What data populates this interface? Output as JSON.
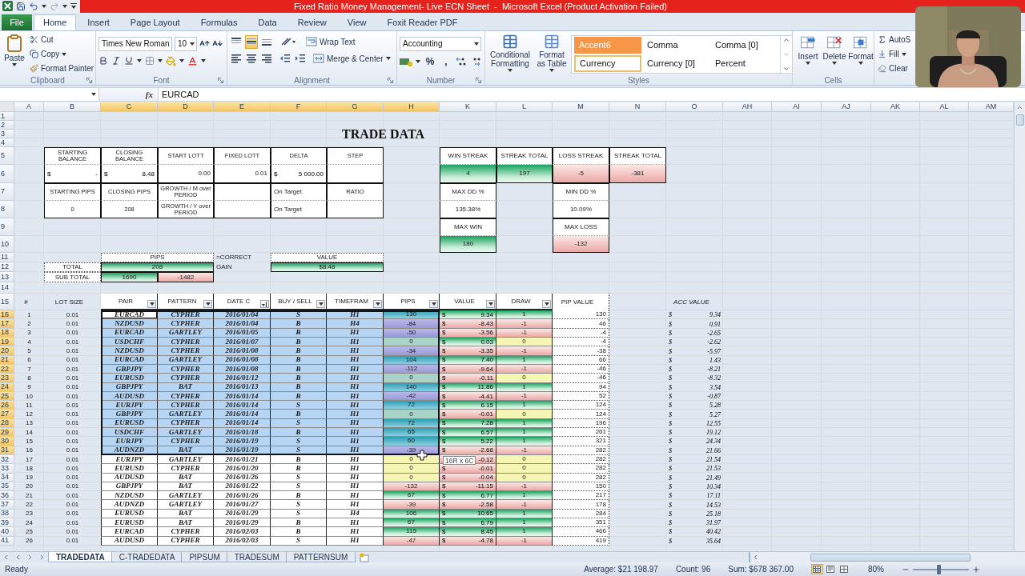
{
  "title_bar": {
    "title": "Fixed Ratio Money Management- Live ECN Sheet  -  Microsoft Excel (Product Activation Failed)"
  },
  "ribbon_tabs": [
    {
      "label": "File",
      "kind": "file",
      "selected": false
    },
    {
      "label": "Home",
      "kind": "tab",
      "selected": true
    },
    {
      "label": "Insert",
      "kind": "tab",
      "selected": false
    },
    {
      "label": "Page Layout",
      "kind": "tab",
      "selected": false
    },
    {
      "label": "Formulas",
      "kind": "tab",
      "selected": false
    },
    {
      "label": "Data",
      "kind": "tab",
      "selected": false
    },
    {
      "label": "Review",
      "kind": "tab",
      "selected": false
    },
    {
      "label": "View",
      "kind": "tab",
      "selected": false
    },
    {
      "label": "Foxit Reader PDF",
      "kind": "tab",
      "selected": false
    }
  ],
  "clipboard": {
    "paste": "Paste",
    "cut": "Cut",
    "copy": "Copy",
    "format_painter": "Format Painter",
    "label": "Clipboard"
  },
  "font": {
    "name": "Times New Roman",
    "size": "10",
    "label": "Font"
  },
  "alignment": {
    "vertical": [
      {
        "selected": false
      },
      {
        "selected": true
      },
      {
        "selected": false
      }
    ],
    "wrap_text": "Wrap Text",
    "merge": "Merge & Center",
    "label": "Alignment"
  },
  "number": {
    "format": "Accounting",
    "percent": "%",
    "comma": ",",
    "label": "Number"
  },
  "styles": {
    "conditional": "Conditional Formatting",
    "format_table": "Format as Table",
    "label": "Styles",
    "gallery": [
      {
        "label": "Accent6",
        "kind": "accent",
        "selected": false
      },
      {
        "label": "Comma",
        "kind": "plain",
        "selected": false
      },
      {
        "label": "Comma [0]",
        "kind": "plain",
        "selected": false
      },
      {
        "label": "Currency",
        "kind": "plain",
        "selected": true
      },
      {
        "label": "Currency [0]",
        "kind": "plain",
        "selected": false
      },
      {
        "label": "Percent",
        "kind": "plain",
        "selected": false
      }
    ]
  },
  "cells": {
    "buttons": [
      "Insert",
      "Delete",
      "Format"
    ],
    "label": "Cells"
  },
  "editing": {
    "autosum": "AutoS",
    "fill": "Fill",
    "clear": "Clear"
  },
  "formula_bar": {
    "fx": "fx",
    "value": "EURCAD"
  },
  "column_headers": [
    {
      "label": "A",
      "selected": false
    },
    {
      "label": "B",
      "selected": false
    },
    {
      "label": "C",
      "selected": true
    },
    {
      "label": "D",
      "selected": true
    },
    {
      "label": "E",
      "selected": true
    },
    {
      "label": "F",
      "selected": true
    },
    {
      "label": "G",
      "selected": true
    },
    {
      "label": "H",
      "selected": true
    },
    {
      "label": "K",
      "selected": false
    },
    {
      "label": "L",
      "selected": false
    },
    {
      "label": "M",
      "selected": false
    },
    {
      "label": "N",
      "selected": false
    },
    {
      "label": "O",
      "selected": false
    },
    {
      "label": "AH",
      "selected": false
    },
    {
      "label": "AI",
      "selected": false
    },
    {
      "label": "AJ",
      "selected": false
    },
    {
      "label": "AK",
      "selected": false
    },
    {
      "label": "AL",
      "selected": false
    },
    {
      "label": "AM",
      "selected": false
    }
  ],
  "row_headers": [
    {
      "label": "1",
      "selected": false
    },
    {
      "label": "2",
      "selected": false
    },
    {
      "label": "3",
      "selected": false
    },
    {
      "label": "4",
      "selected": false
    },
    {
      "label": "5",
      "selected": false
    },
    {
      "label": "6",
      "selected": false
    },
    {
      "label": "7",
      "selected": false
    },
    {
      "label": "8",
      "selected": false
    },
    {
      "label": "9",
      "selected": false
    },
    {
      "label": "10",
      "selected": false
    },
    {
      "label": "11",
      "selected": false
    },
    {
      "label": "12",
      "selected": false
    },
    {
      "label": "13",
      "selected": false
    },
    {
      "label": "14",
      "selected": false
    },
    {
      "label": "15",
      "selected": false
    },
    {
      "label": "16",
      "selected": true
    },
    {
      "label": "17",
      "selected": true
    },
    {
      "label": "18",
      "selected": true
    },
    {
      "label": "19",
      "selected": true
    },
    {
      "label": "20",
      "selected": true
    },
    {
      "label": "21",
      "selected": true
    },
    {
      "label": "22",
      "selected": true
    },
    {
      "label": "23",
      "selected": true
    },
    {
      "label": "24",
      "selected": true
    },
    {
      "label": "25",
      "selected": true
    },
    {
      "label": "26",
      "selected": true
    },
    {
      "label": "27",
      "selected": true
    },
    {
      "label": "28",
      "selected": true
    },
    {
      "label": "29",
      "selected": true
    },
    {
      "label": "30",
      "selected": true
    },
    {
      "label": "31",
      "selected": true
    },
    {
      "label": "32",
      "selected": false
    },
    {
      "label": "33",
      "selected": false
    },
    {
      "label": "34",
      "selected": false
    },
    {
      "label": "35",
      "selected": false
    },
    {
      "label": "36",
      "selected": false
    },
    {
      "label": "37",
      "selected": false
    },
    {
      "label": "38",
      "selected": false
    },
    {
      "label": "39",
      "selected": false
    },
    {
      "label": "40",
      "selected": false
    },
    {
      "label": "41",
      "selected": false
    }
  ],
  "sheet_title": "TRADE DATA",
  "summary": [
    [
      {
        "kind": "label",
        "text": "STARTING BALANCE"
      },
      {
        "kind": "label",
        "text": "CLOSING BALANCE"
      },
      {
        "kind": "label",
        "text": "START LOTT"
      },
      {
        "kind": "label",
        "text": "FIXED LOTT"
      },
      {
        "kind": "label",
        "text": "DELTA"
      },
      {
        "kind": "label",
        "text": "STEP"
      }
    ],
    [
      {
        "kind": "money",
        "symbol": "$",
        "text": "-"
      },
      {
        "kind": "money",
        "symbol": "$",
        "text": "8.48"
      },
      {
        "kind": "number",
        "text": "0.00"
      },
      {
        "kind": "number",
        "text": "0.01"
      },
      {
        "kind": "money",
        "symbol": "$",
        "text": "5 000.00"
      },
      {
        "kind": "empty"
      }
    ],
    [
      {
        "kind": "label",
        "text": "STARTING PIPS"
      },
      {
        "kind": "label",
        "text": "CLOSING PIPS"
      },
      {
        "kind": "label",
        "text": "GROWTH / M over PERIOD"
      },
      {
        "kind": "empty"
      },
      {
        "kind": "note",
        "text": "On Target"
      },
      {
        "kind": "label",
        "text": "RATIO"
      }
    ],
    [
      {
        "kind": "label",
        "text": "0"
      },
      {
        "kind": "label",
        "text": "208"
      },
      {
        "kind": "label",
        "text": "GROWTH / Y over PERIOD"
      },
      {
        "kind": "empty"
      },
      {
        "kind": "note",
        "text": "On Target"
      },
      {
        "kind": "empty"
      }
    ]
  ],
  "streaks": [
    {
      "label": "WIN STREAK",
      "value": "4",
      "kind": "win"
    },
    {
      "label": "STREAK TOTAL",
      "value": "197",
      "kind": "win"
    },
    {
      "label": "LOSS STREAK",
      "value": "-5",
      "kind": "loss"
    },
    {
      "label": "STREAK TOTAL",
      "value": "-381",
      "kind": "loss"
    }
  ],
  "stats": [
    [
      {
        "label": "MAX DD %",
        "value": "135.38%",
        "kind": "plain"
      },
      {
        "label": "MAX WIN",
        "value": "180",
        "kind": "win"
      }
    ],
    [
      {
        "label": "MIN DD %",
        "value": "10.09%",
        "kind": "plain"
      },
      {
        "label": "MAX LOSS",
        "value": "-132",
        "kind": "loss"
      }
    ]
  ],
  "totals": {
    "pips_label": "PIPS",
    "marker": "=CORRECT",
    "value_label": "VALUE",
    "total_label": "TOTAL",
    "total_pips": "208",
    "status": "GAIN",
    "total_value": "$8.48",
    "subtotal_label": "SUB TOTAL",
    "gains": "1690",
    "losses": "-1482"
  },
  "trade_columns": [
    {
      "label": "#",
      "kind": "none"
    },
    {
      "label": "LOT SIZE",
      "kind": "none"
    },
    {
      "label": "PAIR",
      "kind": "dropdown"
    },
    {
      "label": "PATTERN",
      "kind": "dropdown"
    },
    {
      "label": "DATE C",
      "kind": "sorted"
    },
    {
      "label": "BUY / SELL",
      "kind": "dropdown"
    },
    {
      "label": "TIMEFRAM",
      "kind": "dropdown"
    },
    {
      "label": "PIPS",
      "kind": "dropdown"
    },
    {
      "label": "VALUE",
      "kind": "dropdown"
    },
    {
      "label": "DRAW",
      "kind": "dropdown"
    },
    {
      "label": "PIP VALUE",
      "kind": "none"
    },
    {
      "label": "ACC VALUE",
      "kind": "none"
    }
  ],
  "trades": [
    {
      "num": "1",
      "lot": "0.01",
      "pair": "EURCAD",
      "pattern": "CYPHER",
      "date": "2016/01/04",
      "side": "S",
      "timeframe": "H1",
      "pips": "130",
      "value": {
        "symbol": "$",
        "amount": "9.34"
      },
      "draw": "1",
      "pip_value": "130",
      "acc_value": {
        "symbol": "$",
        "amount": "9.34"
      },
      "kind": "win",
      "gain": true,
      "selected": true,
      "active": true
    },
    {
      "num": "2",
      "lot": "0.01",
      "pair": "NZDUSD",
      "pattern": "CYPHER",
      "date": "2016/01/04",
      "side": "B",
      "timeframe": "H4",
      "pips": "-84",
      "value": {
        "symbol": "$",
        "amount": "-8.43"
      },
      "draw": "-1",
      "pip_value": "46",
      "acc_value": {
        "symbol": "$",
        "amount": "0.91"
      },
      "kind": "loss",
      "gain": false,
      "selected": true,
      "active": false
    },
    {
      "num": "3",
      "lot": "0.01",
      "pair": "EURCAD",
      "pattern": "GARTLEY",
      "date": "2016/01/05",
      "side": "B",
      "timeframe": "H1",
      "pips": "-50",
      "value": {
        "symbol": "$",
        "amount": "-3.56"
      },
      "draw": "-1",
      "pip_value": "-4",
      "acc_value": {
        "symbol": "$",
        "amount": "-2.65"
      },
      "kind": "loss",
      "gain": false,
      "selected": true,
      "active": false
    },
    {
      "num": "4",
      "lot": "0.01",
      "pair": "USDCHF",
      "pattern": "CYPHER",
      "date": "2016/01/07",
      "side": "B",
      "timeframe": "H1",
      "pips": "0",
      "value": {
        "symbol": "$",
        "amount": "0.03"
      },
      "draw": "0",
      "pip_value": "-4",
      "acc_value": {
        "symbol": "$",
        "amount": "-2.62"
      },
      "kind": "even",
      "gain": true,
      "selected": true,
      "active": false
    },
    {
      "num": "5",
      "lot": "0.01",
      "pair": "NZDUSD",
      "pattern": "CYPHER",
      "date": "2016/01/08",
      "side": "B",
      "timeframe": "H1",
      "pips": "-34",
      "value": {
        "symbol": "$",
        "amount": "-3.35"
      },
      "draw": "-1",
      "pip_value": "-38",
      "acc_value": {
        "symbol": "$",
        "amount": "-5.97"
      },
      "kind": "loss",
      "gain": false,
      "selected": true,
      "active": false
    },
    {
      "num": "6",
      "lot": "0.01",
      "pair": "EURCAD",
      "pattern": "GARTLEY",
      "date": "2016/01/08",
      "side": "B",
      "timeframe": "H1",
      "pips": "104",
      "value": {
        "symbol": "$",
        "amount": "7.40"
      },
      "draw": "1",
      "pip_value": "66",
      "acc_value": {
        "symbol": "$",
        "amount": "1.43"
      },
      "kind": "win",
      "gain": true,
      "selected": true,
      "active": false
    },
    {
      "num": "7",
      "lot": "0.01",
      "pair": "GBPJPY",
      "pattern": "CYPHER",
      "date": "2016/01/08",
      "side": "B",
      "timeframe": "H1",
      "pips": "-112",
      "value": {
        "symbol": "$",
        "amount": "-9.64"
      },
      "draw": "-1",
      "pip_value": "-46",
      "acc_value": {
        "symbol": "$",
        "amount": "-8.21"
      },
      "kind": "loss",
      "gain": false,
      "selected": true,
      "active": false
    },
    {
      "num": "8",
      "lot": "0.01",
      "pair": "EURUSD",
      "pattern": "CYPHER",
      "date": "2016/01/12",
      "side": "B",
      "timeframe": "H1",
      "pips": "0",
      "value": {
        "symbol": "$",
        "amount": "-0.11"
      },
      "draw": "0",
      "pip_value": "-46",
      "acc_value": {
        "symbol": "$",
        "amount": "-8.32"
      },
      "kind": "even",
      "gain": false,
      "selected": true,
      "active": false
    },
    {
      "num": "9",
      "lot": "0.01",
      "pair": "GBPJPY",
      "pattern": "BAT",
      "date": "2016/01/13",
      "side": "B",
      "timeframe": "H1",
      "pips": "140",
      "value": {
        "symbol": "$",
        "amount": "11.86"
      },
      "draw": "1",
      "pip_value": "94",
      "acc_value": {
        "symbol": "$",
        "amount": "3.54"
      },
      "kind": "win",
      "gain": true,
      "selected": true,
      "active": false
    },
    {
      "num": "10",
      "lot": "0.01",
      "pair": "AUDUSD",
      "pattern": "CYPHER",
      "date": "2016/01/14",
      "side": "B",
      "timeframe": "H1",
      "pips": "-42",
      "value": {
        "symbol": "$",
        "amount": "-4.41"
      },
      "draw": "-1",
      "pip_value": "52",
      "acc_value": {
        "symbol": "$",
        "amount": "-0.87"
      },
      "kind": "loss",
      "gain": false,
      "selected": true,
      "active": false
    },
    {
      "num": "11",
      "lot": "0.01",
      "pair": "EURJPY",
      "pattern": "CYPHER",
      "date": "2016/01/14",
      "side": "S",
      "timeframe": "H1",
      "pips": "72",
      "value": {
        "symbol": "$",
        "amount": "6.15"
      },
      "draw": "1",
      "pip_value": "124",
      "acc_value": {
        "symbol": "$",
        "amount": "5.28"
      },
      "kind": "win",
      "gain": true,
      "selected": true,
      "active": false
    },
    {
      "num": "12",
      "lot": "0.01",
      "pair": "GBPJPY",
      "pattern": "GARTLEY",
      "date": "2016/01/14",
      "side": "B",
      "timeframe": "H1",
      "pips": "0",
      "value": {
        "symbol": "$",
        "amount": "-0.01"
      },
      "draw": "0",
      "pip_value": "124",
      "acc_value": {
        "symbol": "$",
        "amount": "5.27"
      },
      "kind": "even",
      "gain": false,
      "selected": true,
      "active": false
    },
    {
      "num": "13",
      "lot": "0.01",
      "pair": "EURUSD",
      "pattern": "CYPHER",
      "date": "2016/01/14",
      "side": "S",
      "timeframe": "H1",
      "pips": "72",
      "value": {
        "symbol": "$",
        "amount": "7.28"
      },
      "draw": "1",
      "pip_value": "196",
      "acc_value": {
        "symbol": "$",
        "amount": "12.55"
      },
      "kind": "win",
      "gain": true,
      "selected": true,
      "active": false
    },
    {
      "num": "14",
      "lot": "0.01",
      "pair": "USDCHF",
      "pattern": "GARTLEY",
      "date": "2016/01/18",
      "side": "B",
      "timeframe": "H1",
      "pips": "65",
      "value": {
        "symbol": "$",
        "amount": "6.57"
      },
      "draw": "1",
      "pip_value": "261",
      "acc_value": {
        "symbol": "$",
        "amount": "19.12"
      },
      "kind": "win",
      "gain": true,
      "selected": true,
      "active": false
    },
    {
      "num": "15",
      "lot": "0.01",
      "pair": "EURJPY",
      "pattern": "CYPHER",
      "date": "2016/01/19",
      "side": "S",
      "timeframe": "H1",
      "pips": "60",
      "value": {
        "symbol": "$",
        "amount": "5.22"
      },
      "draw": "1",
      "pip_value": "321",
      "acc_value": {
        "symbol": "$",
        "amount": "24.34"
      },
      "kind": "win",
      "gain": true,
      "selected": true,
      "active": false
    },
    {
      "num": "16",
      "lot": "0.01",
      "pair": "AUDNZD",
      "pattern": "BAT",
      "date": "2016/01/19",
      "side": "S",
      "timeframe": "H1",
      "pips": "-39",
      "value": {
        "symbol": "$",
        "amount": "-2.68"
      },
      "draw": "-1",
      "pip_value": "282",
      "acc_value": {
        "symbol": "$",
        "amount": "21.66"
      },
      "kind": "loss",
      "gain": false,
      "selected": true,
      "active": false
    },
    {
      "num": "17",
      "lot": "0.01",
      "pair": "EURJPY",
      "pattern": "GARTLEY",
      "date": "2016/01/21",
      "side": "B",
      "timeframe": "H1",
      "pips": "0",
      "value": {
        "amount": "-0.12"
      },
      "draw": "0",
      "pip_value": "282",
      "acc_value": {
        "symbol": "$",
        "amount": "21.54"
      },
      "kind": "even",
      "gain": false,
      "selected": false,
      "active": false
    },
    {
      "num": "18",
      "lot": "0.01",
      "pair": "EURUSD",
      "pattern": "CYPHER",
      "date": "2016/01/20",
      "side": "B",
      "timeframe": "H1",
      "pips": "0",
      "value": {
        "symbol": "$",
        "amount": "-0.01"
      },
      "draw": "0",
      "pip_value": "282",
      "acc_value": {
        "symbol": "$",
        "amount": "21.53"
      },
      "kind": "even",
      "gain": false,
      "selected": false,
      "active": false
    },
    {
      "num": "19",
      "lot": "0.01",
      "pair": "AUDUSD",
      "pattern": "BAT",
      "date": "2016/01/26",
      "side": "S",
      "timeframe": "H1",
      "pips": "0",
      "value": {
        "symbol": "$",
        "amount": "-0.04"
      },
      "draw": "0",
      "pip_value": "282",
      "acc_value": {
        "symbol": "$",
        "amount": "21.49"
      },
      "kind": "even",
      "gain": false,
      "selected": false,
      "active": false
    },
    {
      "num": "20",
      "lot": "0.01",
      "pair": "GBPJPY",
      "pattern": "BAT",
      "date": "2016/01/22",
      "side": "S",
      "timeframe": "H1",
      "pips": "-132",
      "value": {
        "symbol": "$",
        "amount": "-11.15"
      },
      "draw": "-1",
      "pip_value": "150",
      "acc_value": {
        "symbol": "$",
        "amount": "10.34"
      },
      "kind": "loss",
      "gain": false,
      "selected": false,
      "active": false
    },
    {
      "num": "21",
      "lot": "0.01",
      "pair": "NZDUSD",
      "pattern": "GARTLEY",
      "date": "2016/01/26",
      "side": "B",
      "timeframe": "H1",
      "pips": "67",
      "value": {
        "symbol": "$",
        "amount": "6.77"
      },
      "draw": "1",
      "pip_value": "217",
      "acc_value": {
        "symbol": "$",
        "amount": "17.11"
      },
      "kind": "win",
      "gain": true,
      "selected": false,
      "active": false
    },
    {
      "num": "22",
      "lot": "0.01",
      "pair": "AUDNZD",
      "pattern": "GARTLEY",
      "date": "2016/01/27",
      "side": "S",
      "timeframe": "H1",
      "pips": "-39",
      "value": {
        "symbol": "$",
        "amount": "-2.58"
      },
      "draw": "-1",
      "pip_value": "178",
      "acc_value": {
        "symbol": "$",
        "amount": "14.53"
      },
      "kind": "loss",
      "gain": false,
      "selected": false,
      "active": false
    },
    {
      "num": "23",
      "lot": "0.01",
      "pair": "EURUSD",
      "pattern": "BAT",
      "date": "2016/01/29",
      "side": "S",
      "timeframe": "H4",
      "pips": "106",
      "value": {
        "symbol": "$",
        "amount": "10.65"
      },
      "draw": "1",
      "pip_value": "284",
      "acc_value": {
        "symbol": "$",
        "amount": "25.18"
      },
      "kind": "win",
      "gain": true,
      "selected": false,
      "active": false
    },
    {
      "num": "24",
      "lot": "0.01",
      "pair": "EURUSD",
      "pattern": "BAT",
      "date": "2016/01/29",
      "side": "B",
      "timeframe": "H1",
      "pips": "67",
      "value": {
        "symbol": "$",
        "amount": "6.79"
      },
      "draw": "1",
      "pip_value": "351",
      "acc_value": {
        "symbol": "$",
        "amount": "31.97"
      },
      "kind": "win",
      "gain": true,
      "selected": false,
      "active": false
    },
    {
      "num": "25",
      "lot": "0.01",
      "pair": "EURCAD",
      "pattern": "CYPHER",
      "date": "2016/02/03",
      "side": "B",
      "timeframe": "H1",
      "pips": "115",
      "value": {
        "symbol": "$",
        "amount": "8.45"
      },
      "draw": "1",
      "pip_value": "466",
      "acc_value": {
        "symbol": "$",
        "amount": "40.42"
      },
      "kind": "win",
      "gain": true,
      "selected": false,
      "active": false
    },
    {
      "num": "26",
      "lot": "0.01",
      "pair": "AUDUSD",
      "pattern": "CYPHER",
      "date": "2016/02/03",
      "side": "S",
      "timeframe": "H1",
      "pips": "-47",
      "value": {
        "symbol": "$",
        "amount": "-4.78"
      },
      "draw": "-1",
      "pip_value": "419",
      "acc_value": {
        "symbol": "$",
        "amount": "35.64"
      },
      "kind": "loss",
      "gain": false,
      "selected": false,
      "active": false
    }
  ],
  "selection_tooltip": "16R x 6C",
  "sheet_tabs": [
    {
      "label": "TRADEDATA",
      "selected": true
    },
    {
      "label": "C-TRADEDATA",
      "selected": false
    },
    {
      "label": "PIPSUM",
      "selected": false
    },
    {
      "label": "TRADESUM",
      "selected": false
    },
    {
      "label": "PATTERNSUM",
      "selected": false
    }
  ],
  "status_bar": {
    "mode": "Ready",
    "average": "Average: $21 198.97",
    "count": "Count: 96",
    "sum": "Sum: $678 367.00",
    "zoom": "80%",
    "level": 0.45,
    "views": [
      {
        "selected": true
      },
      {
        "selected": false
      },
      {
        "selected": false
      }
    ]
  }
}
